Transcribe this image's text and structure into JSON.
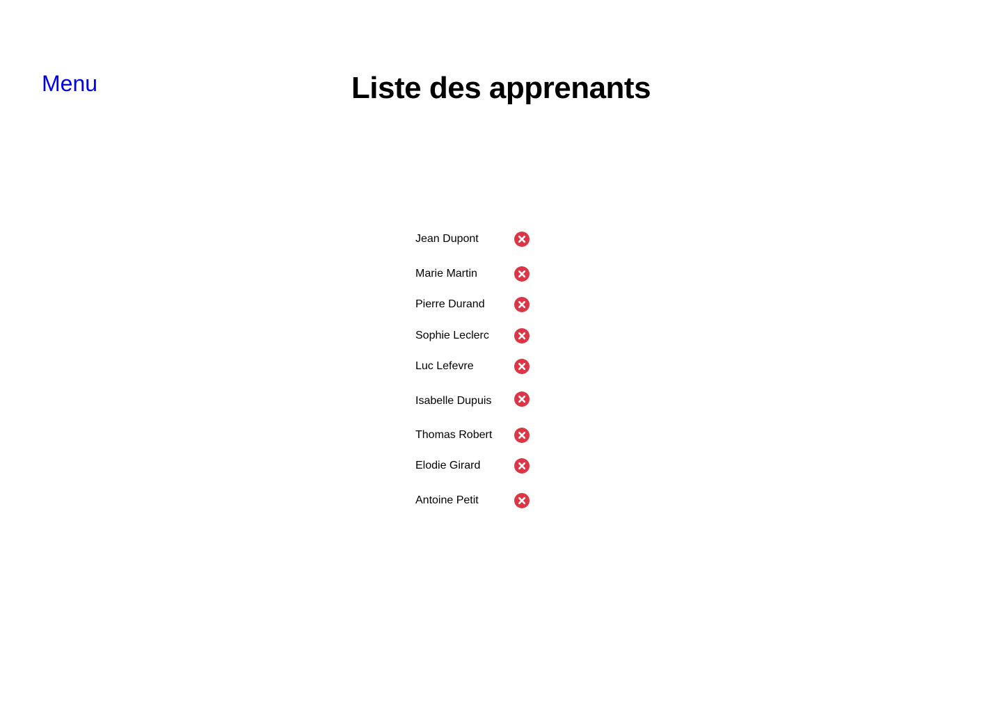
{
  "header": {
    "menu_label": "Menu",
    "title": "Liste des apprenants"
  },
  "learners": [
    {
      "name": "Jean Dupont"
    },
    {
      "name": "Marie Martin"
    },
    {
      "name": "Pierre Durand"
    },
    {
      "name": "Sophie Leclerc"
    },
    {
      "name": "Luc Lefevre"
    },
    {
      "name": "Isabelle Dupuis"
    },
    {
      "name": "Thomas Robert"
    },
    {
      "name": "Elodie Girard"
    },
    {
      "name": "Antoine Petit"
    }
  ],
  "icons": {
    "delete": "close-circle-icon"
  },
  "colors": {
    "link": "#0000ee",
    "delete_icon": "#dc3545"
  }
}
